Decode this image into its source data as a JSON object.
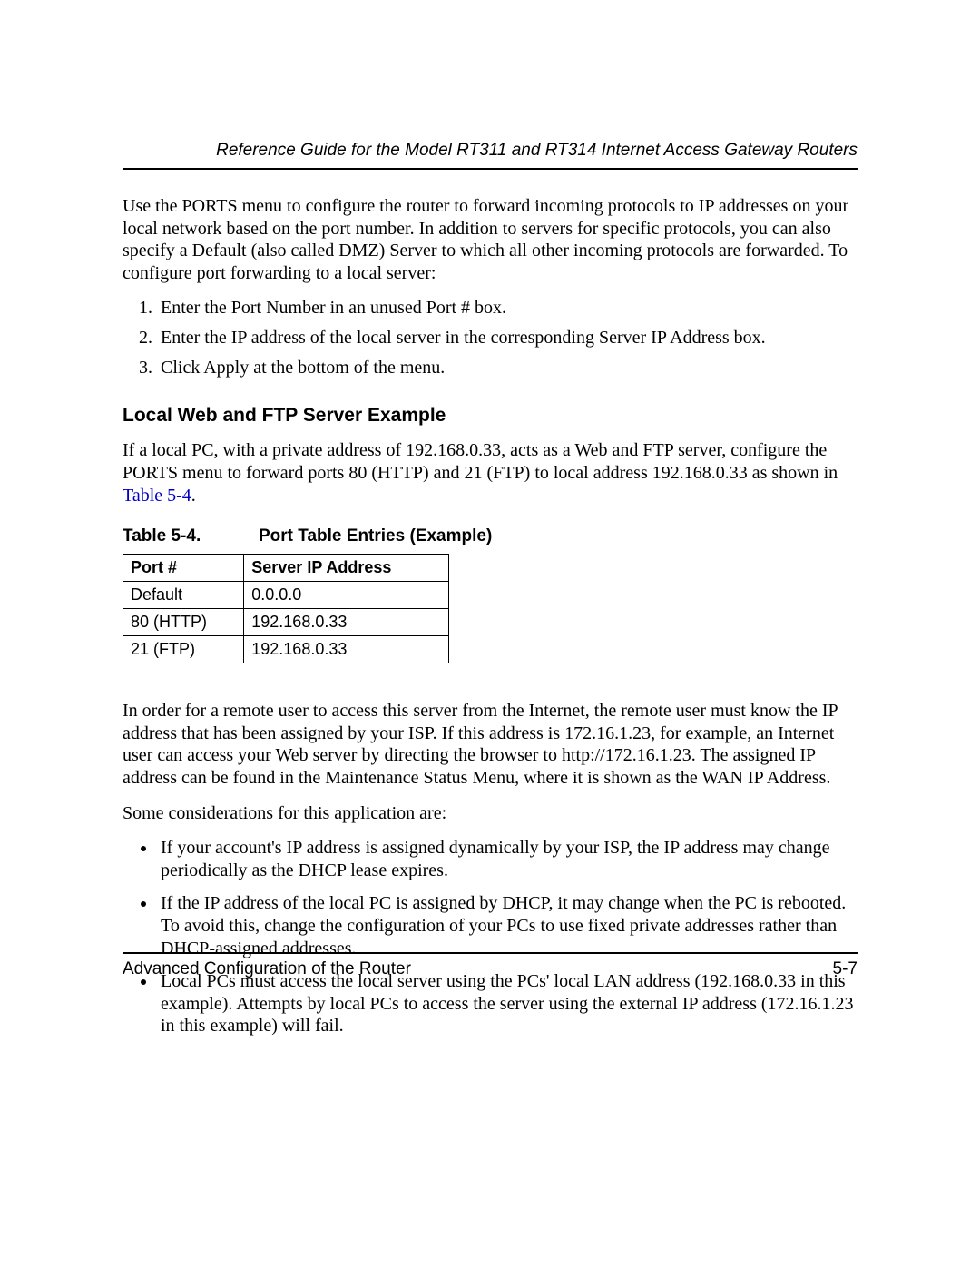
{
  "header": {
    "title": "Reference Guide for the Model RT311 and RT314 Internet Access Gateway Routers"
  },
  "intro_para": "Use the PORTS menu to configure the router to forward incoming protocols to IP addresses on your local network based on the port number. In addition to servers for specific protocols, you can also specify a Default (also called DMZ) Server to which all other incoming protocols are forwarded. To configure port forwarding to a local server:",
  "steps": [
    "Enter the Port Number in an unused Port # box.",
    "Enter the IP address of the local server in the corresponding Server IP Address box.",
    "Click Apply at the bottom of the menu."
  ],
  "subheading": "Local Web and FTP Server Example",
  "example_para_prefix": "If a local PC, with a private address of 192.168.0.33, acts as a Web and FTP server, configure the PORTS menu to forward ports 80 (HTTP) and 21 (FTP) to local address 192.168.0.33 as shown in ",
  "example_para_ref": "Table 5-4",
  "example_para_suffix": ".",
  "table": {
    "caption_num": "Table 5-4.",
    "caption_title": "Port Table Entries (Example)",
    "headers": [
      "Port #",
      "Server IP Address"
    ],
    "rows": [
      [
        "Default",
        "0.0.0.0"
      ],
      [
        "80 (HTTP)",
        "192.168.0.33"
      ],
      [
        "21 (FTP)",
        "192.168.0.33"
      ]
    ]
  },
  "after_table_para": "In order for a remote user to access this server from the Internet, the remote user must know the IP address that has been assigned by your ISP. If this address is 172.16.1.23, for example, an Internet user can access your Web server by directing the browser to http://172.16.1.23. The assigned IP address can be found in the Maintenance Status Menu, where it is shown as the WAN IP Address.",
  "considerations_lead": "Some considerations for this application are:",
  "considerations": [
    "If your account's IP address is assigned dynamically by your ISP, the IP address may change periodically as the DHCP lease expires.",
    "If the IP address of the local PC is assigned by DHCP, it may change when the PC is rebooted. To avoid this, change the configuration of your PCs to use fixed private addresses rather than DHCP-assigned addresses.",
    "Local PCs must access the local server using the PCs' local LAN address (192.168.0.33 in this example). Attempts by local PCs to access the server using the external IP address (172.16.1.23 in this example) will fail."
  ],
  "footer": {
    "section": "Advanced Configuration of the Router",
    "page": "5-7"
  }
}
